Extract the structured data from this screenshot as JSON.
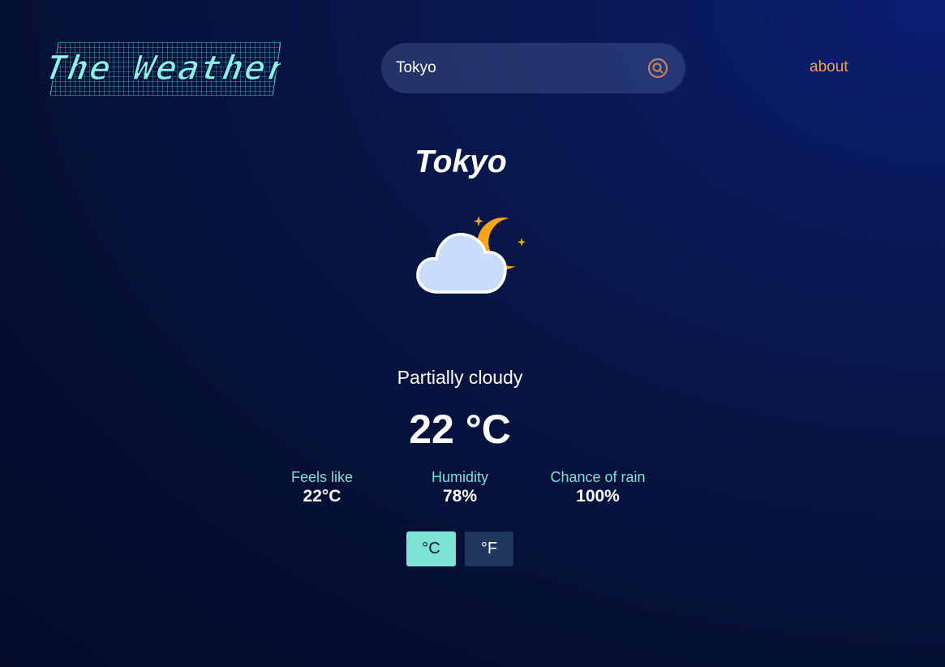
{
  "header": {
    "logo_text": "The Weather",
    "search": {
      "value": "Tokyo",
      "placeholder": ""
    },
    "about_label": "about"
  },
  "weather": {
    "city": "Tokyo",
    "icon": "partly-cloudy-night-icon",
    "condition": "Partially cloudy",
    "temperature": "22 °C"
  },
  "stats": {
    "feels_like": {
      "label": "Feels like",
      "value": "22°C"
    },
    "humidity": {
      "label": "Humidity",
      "value": "78%"
    },
    "chance_of_rain": {
      "label": "Chance of rain",
      "value": "100%"
    }
  },
  "units": {
    "celsius_label": "°C",
    "fahrenheit_label": "°F",
    "selected": "°C"
  },
  "colors": {
    "accent_teal": "#7de3d5",
    "about_orange": "#f5a15a",
    "search_icon": "#c9805a",
    "moon": "#f9a51a",
    "cloud": "#c7ddfb"
  }
}
